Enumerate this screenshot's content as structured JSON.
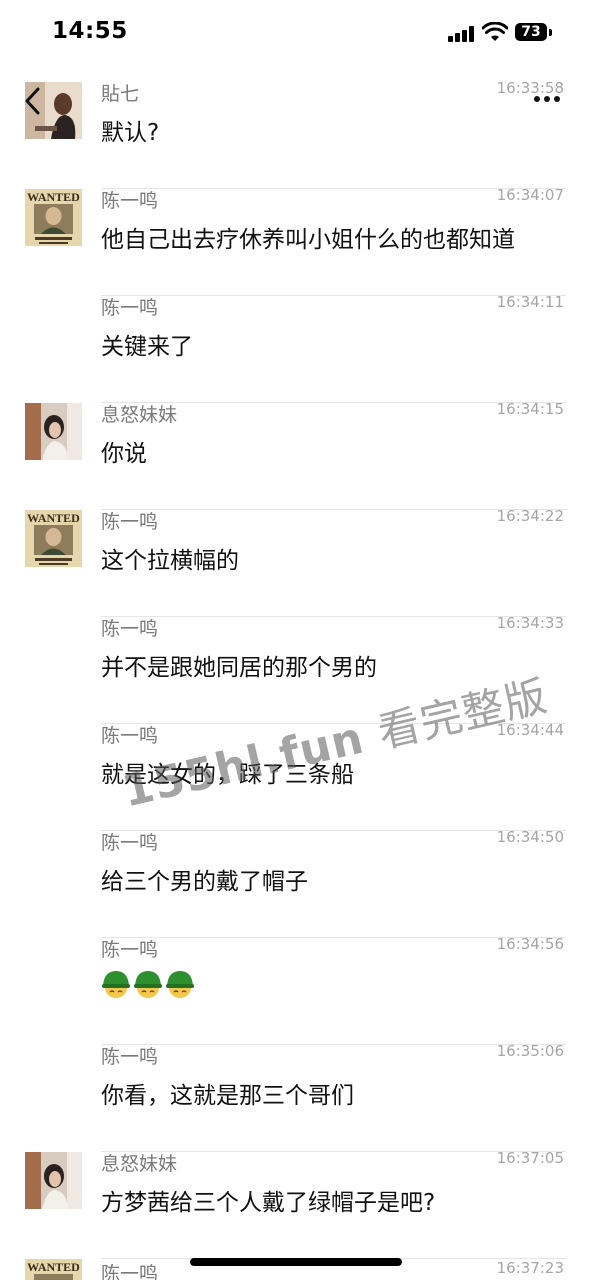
{
  "status_bar": {
    "time": "14:55",
    "battery": "73"
  },
  "messages": [
    {
      "sender": "貼七",
      "time": "16:33:58",
      "text": "默认?",
      "avatar": "photo-avatar"
    },
    {
      "sender": "陈一鸣",
      "time": "16:34:07",
      "text": "他自己出去疗休养叫小姐什么的也都知道",
      "avatar": "wanted-poster-avatar"
    },
    {
      "sender": "陈一鸣",
      "time": "16:34:11",
      "text": "关键来了",
      "avatar": ""
    },
    {
      "sender": "息怒妹妹",
      "time": "16:34:15",
      "text": "你说",
      "avatar": "girl-avatar"
    },
    {
      "sender": "陈一鸣",
      "time": "16:34:22",
      "text": "这个拉横幅的",
      "avatar": "wanted-poster-avatar"
    },
    {
      "sender": "陈一鸣",
      "time": "16:34:33",
      "text": "并不是跟她同居的那个男的",
      "avatar": ""
    },
    {
      "sender": "陈一鸣",
      "time": "16:34:44",
      "text": "就是这女的，踩了三条船",
      "avatar": ""
    },
    {
      "sender": "陈一鸣",
      "time": "16:34:50",
      "text": "给三个男的戴了帽子",
      "avatar": ""
    },
    {
      "sender": "陈一鸣",
      "time": "16:34:56",
      "text": "",
      "emoji_count": 3,
      "avatar": ""
    },
    {
      "sender": "陈一鸣",
      "time": "16:35:06",
      "text": "你看，这就是那三个哥们",
      "avatar": ""
    },
    {
      "sender": "息怒妹妹",
      "time": "16:37:05",
      "text": "方梦茜给三个人戴了绿帽子是吧?",
      "avatar": "girl-avatar"
    },
    {
      "sender": "陈一鸣",
      "time": "16:37:23",
      "text": "",
      "avatar": "wanted-poster-avatar"
    }
  ],
  "avatars": {
    "wanted_text": "WANTED"
  },
  "watermark": {
    "domain": "155hl.fun",
    "text": "看完整版"
  },
  "colors": {
    "background": "#ffffff",
    "sender": "#7a7a7a",
    "timestamp": "#a6a6a6",
    "divider": "#e6e6e6",
    "helmet": "#2f8f2f"
  }
}
